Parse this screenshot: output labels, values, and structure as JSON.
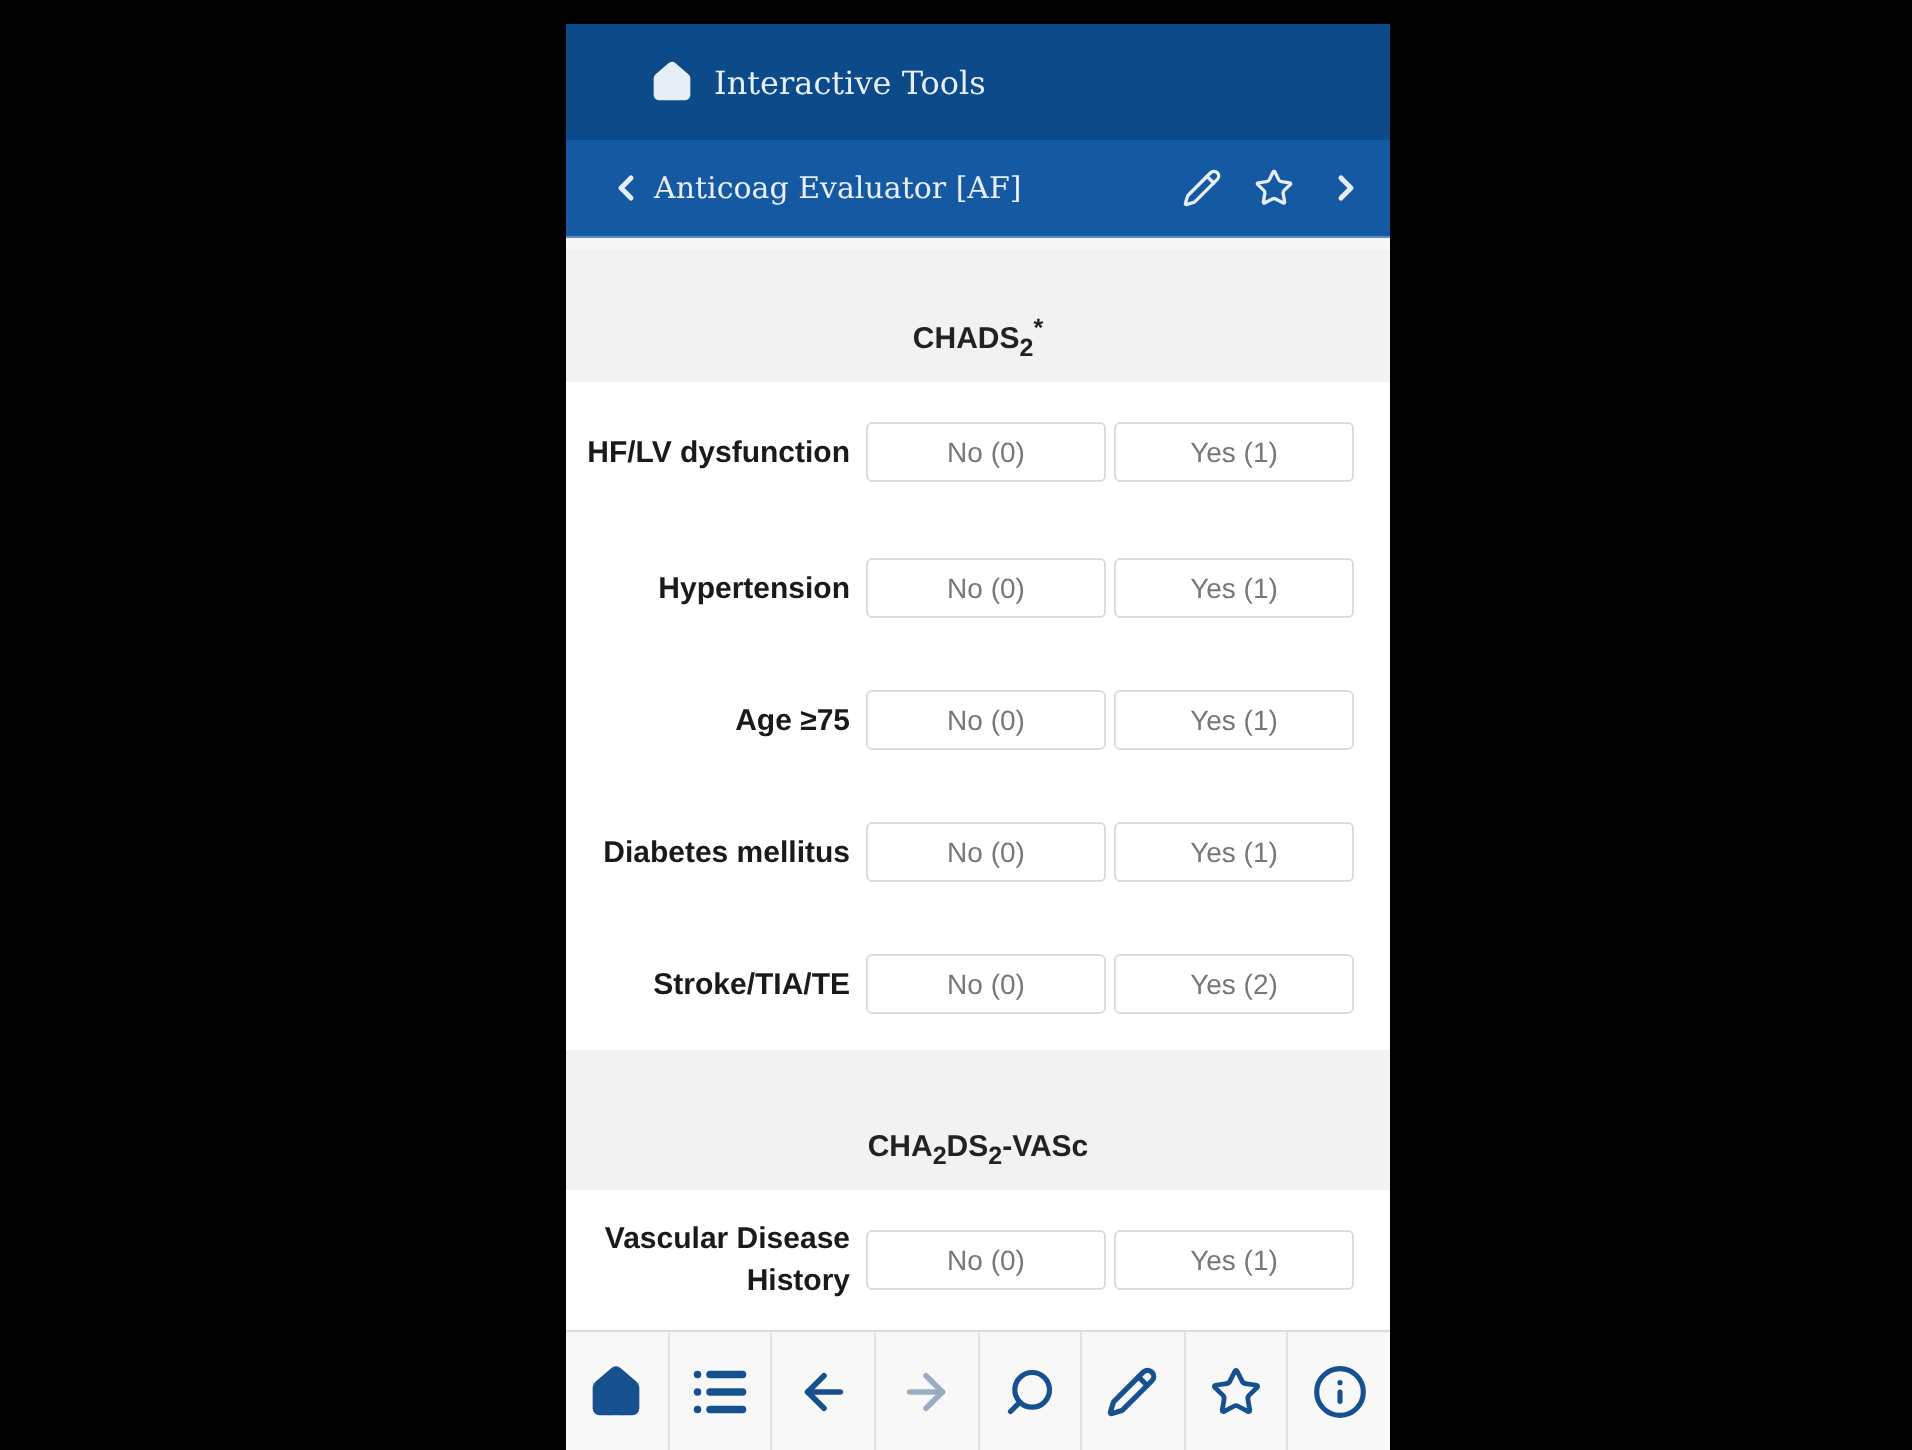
{
  "app_bar": {
    "title": "Interactive Tools"
  },
  "nav_bar": {
    "title": "Anticoag Evaluator [AF]"
  },
  "sections": [
    {
      "title": "CHADS$_{2}$$^{*}$",
      "rows": [
        {
          "label": "HF/LV dysfunction",
          "options": [
            {
              "label": "No (0)",
              "selected": false
            },
            {
              "label": "Yes (1)",
              "selected": false
            }
          ]
        },
        {
          "label": "Hypertension",
          "options": [
            {
              "label": "No (0)",
              "selected": false
            },
            {
              "label": "Yes (1)",
              "selected": false
            }
          ]
        },
        {
          "label": "Age ≥75",
          "options": [
            {
              "label": "No (0)",
              "selected": false
            },
            {
              "label": "Yes (1)",
              "selected": false
            }
          ]
        },
        {
          "label": "Diabetes mellitus",
          "options": [
            {
              "label": "No (0)",
              "selected": false
            },
            {
              "label": "Yes (1)",
              "selected": false
            }
          ]
        },
        {
          "label": "Stroke/TIA/TE",
          "options": [
            {
              "label": "No (0)",
              "selected": false
            },
            {
              "label": "Yes (2)",
              "selected": false
            }
          ]
        }
      ]
    },
    {
      "title": "CHA$_{2}$DS$_{2}$-VASc",
      "rows": [
        {
          "label": "Vascular Disease History",
          "options": [
            {
              "label": "No (0)",
              "selected": false
            },
            {
              "label": "Yes (1)",
              "selected": false
            }
          ]
        }
      ]
    }
  ],
  "toolbar": [
    {
      "kind": "home",
      "disabled": false
    },
    {
      "kind": "list",
      "disabled": false
    },
    {
      "kind": "back",
      "disabled": false
    },
    {
      "kind": "forward",
      "disabled": true
    },
    {
      "kind": "search",
      "disabled": false
    },
    {
      "kind": "edit",
      "disabled": false
    },
    {
      "kind": "favorite",
      "disabled": false
    },
    {
      "kind": "info",
      "disabled": false
    }
  ]
}
